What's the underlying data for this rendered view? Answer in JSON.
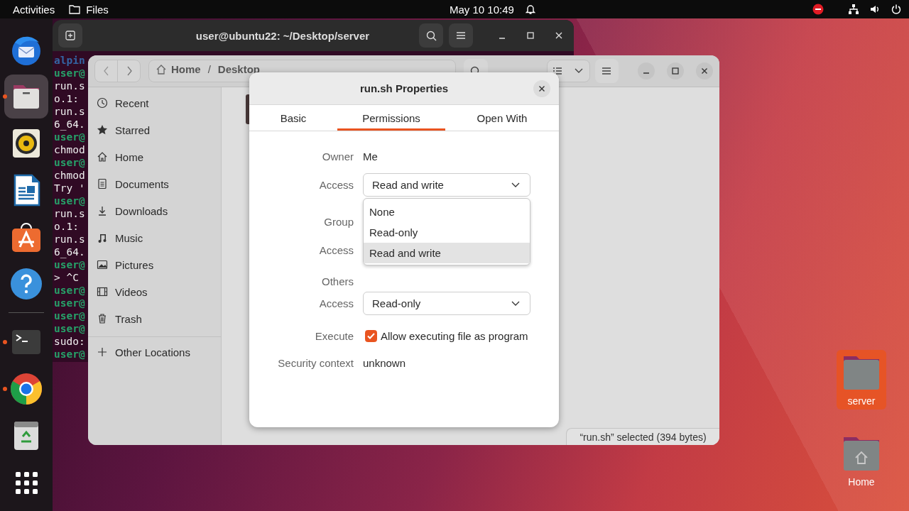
{
  "top_bar": {
    "activities": "Activities",
    "app_menu": "Files",
    "clock": "May 10  10:49"
  },
  "dock": [
    {
      "kind": "mail",
      "running": false,
      "selected": false
    },
    {
      "kind": "files",
      "running": true,
      "selected": true
    },
    {
      "kind": "speaker",
      "running": false,
      "selected": false
    },
    {
      "kind": "writer",
      "running": false,
      "selected": false
    },
    {
      "kind": "store",
      "running": false,
      "selected": false
    },
    {
      "kind": "help",
      "running": false,
      "selected": false
    },
    {
      "kind": "separator"
    },
    {
      "kind": "terminal",
      "running": true,
      "selected": false
    },
    {
      "kind": "browser",
      "running": true,
      "selected": false
    },
    {
      "kind": "trash",
      "running": false,
      "selected": false
    },
    {
      "kind": "grid",
      "running": false,
      "selected": false
    }
  ],
  "terminal": {
    "title": "user@ubuntu22: ~/Desktop/server",
    "lines": [
      {
        "kind": "info",
        "text": "alpin"
      },
      {
        "kind": "prompt",
        "text": "user@"
      },
      {
        "kind": "output",
        "text": "run.s"
      },
      {
        "kind": "output",
        "text": "o.1: "
      },
      {
        "kind": "output",
        "text": "run.s"
      },
      {
        "kind": "output",
        "text": "6_64."
      },
      {
        "kind": "prompt",
        "text": "user@"
      },
      {
        "kind": "output",
        "text": "chmod"
      },
      {
        "kind": "prompt",
        "text": "user@"
      },
      {
        "kind": "output",
        "text": "chmod"
      },
      {
        "kind": "output",
        "text": "Try '"
      },
      {
        "kind": "prompt",
        "text": "user@"
      },
      {
        "kind": "output",
        "text": "run.s"
      },
      {
        "kind": "output",
        "text": "o.1: "
      },
      {
        "kind": "output",
        "text": "run.s"
      },
      {
        "kind": "output",
        "text": "6_64."
      },
      {
        "kind": "prompt",
        "text": "user@"
      },
      {
        "kind": "output",
        "text": "> ^C"
      },
      {
        "kind": "prompt",
        "text": "user@"
      },
      {
        "kind": "prompt",
        "text": "user@"
      },
      {
        "kind": "prompt",
        "text": "user@"
      },
      {
        "kind": "prompt",
        "text": "user@"
      },
      {
        "kind": "output",
        "text": "sudo:"
      },
      {
        "kind": "prompt",
        "text": "user@"
      }
    ]
  },
  "files": {
    "path": [
      "Home",
      "/",
      "Desktop"
    ],
    "sidebar": [
      {
        "kind": "clock",
        "label": "Recent"
      },
      {
        "kind": "star",
        "label": "Starred"
      },
      {
        "kind": "home",
        "label": "Home"
      },
      {
        "kind": "document",
        "label": "Documents"
      },
      {
        "kind": "download",
        "label": "Downloads"
      },
      {
        "kind": "music",
        "label": "Music"
      },
      {
        "kind": "picture",
        "label": "Pictures"
      },
      {
        "kind": "film",
        "label": "Videos"
      },
      {
        "kind": "trash",
        "label": "Trash"
      },
      {
        "kind": "plus",
        "label": "Other Locations"
      }
    ],
    "status": "“run.sh” selected  (394 bytes)"
  },
  "dialog": {
    "title": "run.sh Properties",
    "tabs": [
      {
        "label": "Basic",
        "selected": false
      },
      {
        "label": "Permissions",
        "selected": true
      },
      {
        "label": "Open With",
        "selected": false
      }
    ],
    "owner": {
      "label": "Owner",
      "value": "Me"
    },
    "owner_access": {
      "label": "Access",
      "value": "Read and write",
      "options": [
        {
          "label": "None",
          "selected": false
        },
        {
          "label": "Read-only",
          "selected": false
        },
        {
          "label": "Read and write",
          "selected": true
        }
      ]
    },
    "group": {
      "label": "Group",
      "access_label": "Access"
    },
    "others": {
      "label": "Others",
      "access_label": "Access",
      "value": "Read-only"
    },
    "execute": {
      "label": "Execute",
      "text": "Allow executing file as program",
      "checked": true
    },
    "security": {
      "label": "Security context",
      "value": "unknown"
    }
  },
  "desktop_icons": [
    {
      "label": "server",
      "selected": true,
      "kind": "folder"
    },
    {
      "label": "Home",
      "selected": false,
      "kind": "home"
    }
  ]
}
